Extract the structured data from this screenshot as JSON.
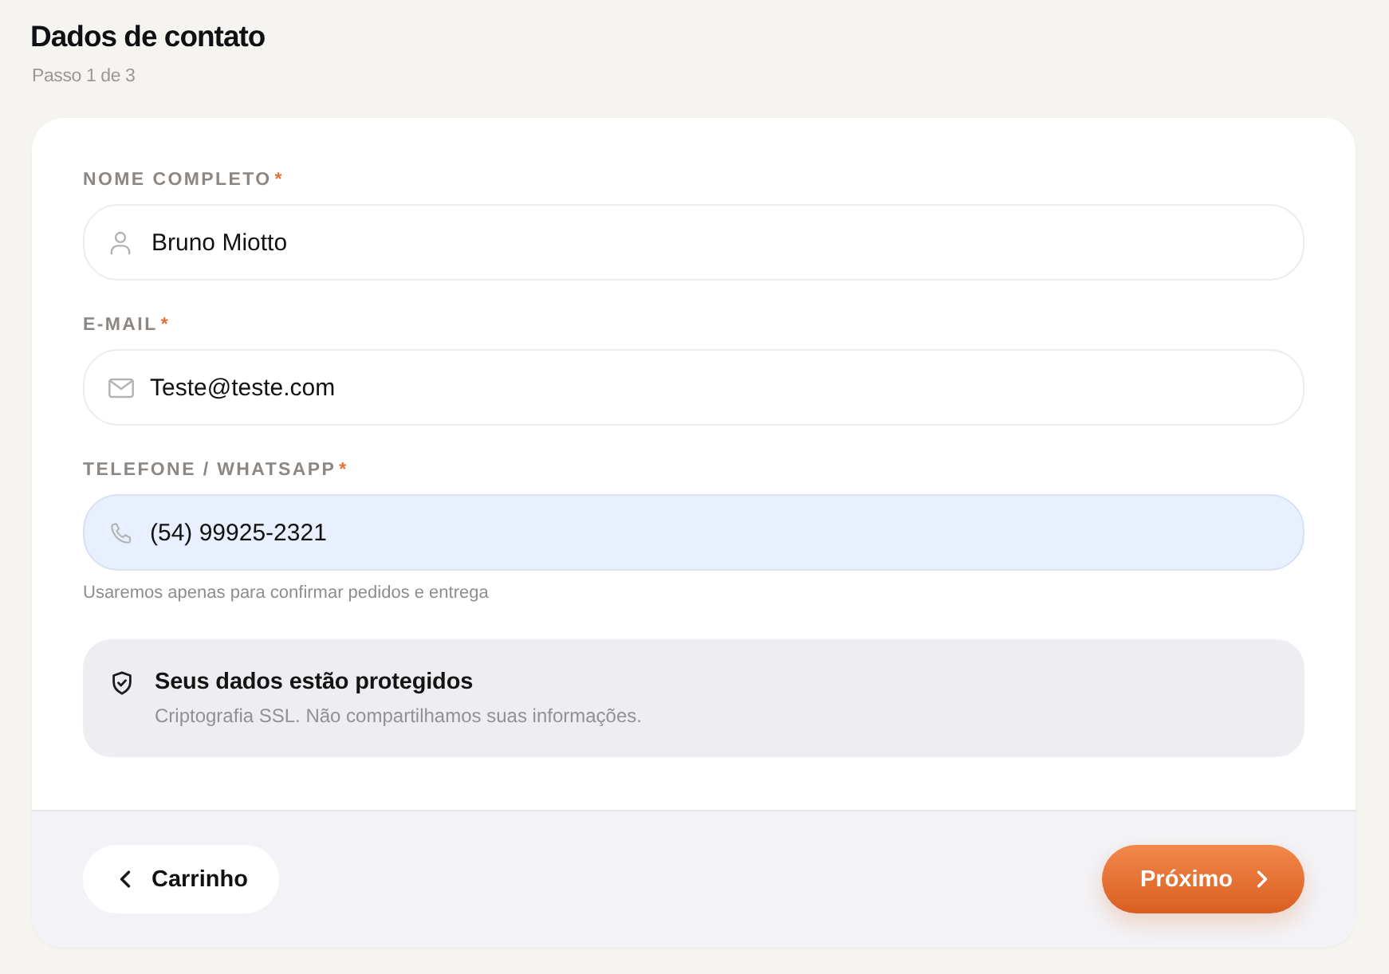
{
  "header": {
    "title": "Dados de contato",
    "step": "Passo 1 de 3"
  },
  "fields": [
    {
      "kind": "name",
      "label": "NOME COMPLETO",
      "required_mark": "*",
      "value": "Bruno Miotto",
      "autofilled": false
    },
    {
      "kind": "email",
      "label": "E-MAIL",
      "required_mark": "*",
      "value": "Teste@teste.com",
      "autofilled": false
    },
    {
      "kind": "phone",
      "label": "TELEFONE / WHATSAPP",
      "required_mark": "*",
      "value": "(54) 99925-2321",
      "autofilled": true,
      "hint": "Usaremos apenas para confirmar pedidos e entrega"
    }
  ],
  "security_note": {
    "title": "Seus dados estão protegidos",
    "text": "Criptografia SSL. Não compartilhamos suas informações."
  },
  "footer": {
    "back_button": "Carrinho",
    "next_button": "Próximo"
  }
}
